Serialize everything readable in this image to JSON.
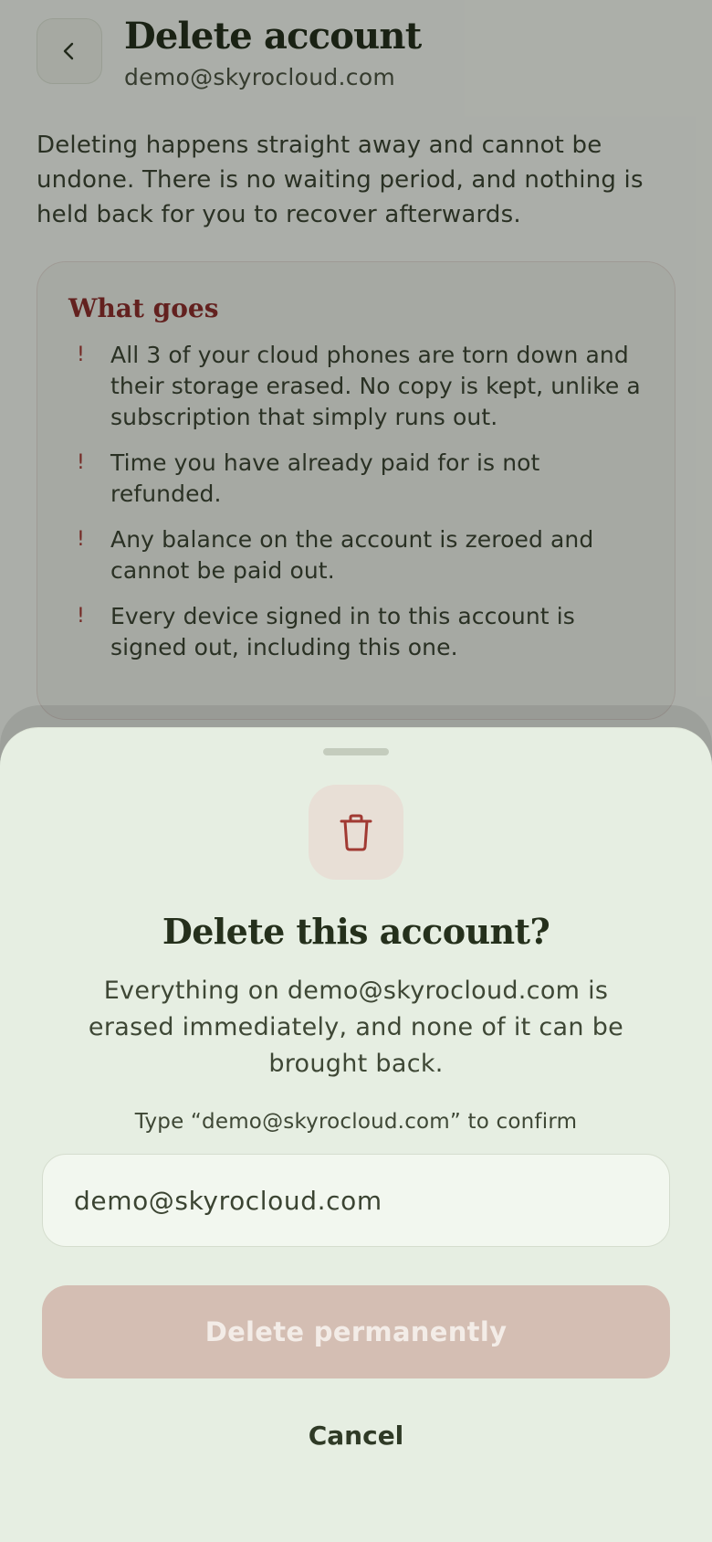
{
  "header": {
    "title": "Delete account",
    "subtitle": "demo@skyrocloud.com"
  },
  "intro": "Deleting happens straight away and cannot be undone. There is no waiting period, and nothing is held back for you to recover afterwards.",
  "card": {
    "title": "What goes",
    "items": [
      {
        "marker": "!",
        "text": "All 3 of your cloud phones are torn down and their storage erased. No copy is kept, unlike a subscription that simply runs out."
      },
      {
        "marker": "!",
        "text": "Time you have already paid for is not refunded."
      },
      {
        "marker": "!",
        "text": "Any balance on the account is zeroed and cannot be paid out."
      },
      {
        "marker": "!",
        "text": "Every device signed in to this account is signed out, including this one."
      }
    ]
  },
  "sheet": {
    "title": "Delete this account?",
    "description": "Everything on demo@skyrocloud.com is erased immediately, and none of it can be brought back.",
    "confirm_label": "Type “demo@skyrocloud.com” to confirm",
    "input_value": "demo@skyrocloud.com",
    "delete_label": "Delete permanently",
    "cancel_label": "Cancel"
  },
  "colors": {
    "accent_danger": "#a13a33",
    "delete_button_disabled": "#d4beb3",
    "sheet_background": "#e6eee2"
  },
  "icons": {
    "back": "chevron-left-icon",
    "sheet": "trash-icon"
  }
}
